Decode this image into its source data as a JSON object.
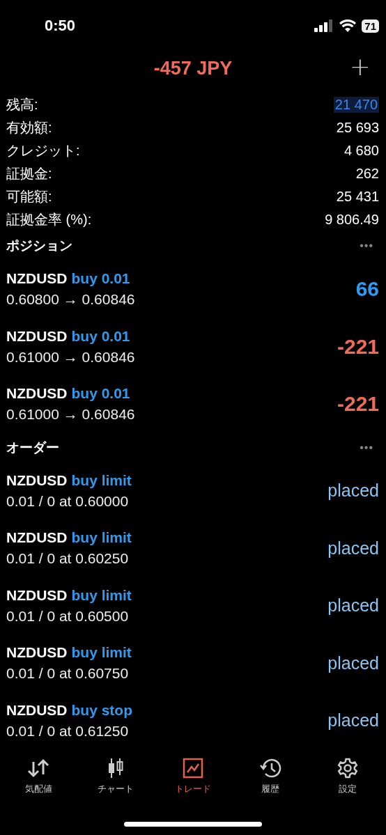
{
  "status_bar": {
    "time": "0:50",
    "battery": "71"
  },
  "header": {
    "title": "-457 JPY",
    "add": "+"
  },
  "summary": [
    {
      "label": "残高:",
      "value": "21 470",
      "highlighted": true
    },
    {
      "label": "有効額:",
      "value": "25 693",
      "highlighted": false
    },
    {
      "label": "クレジット:",
      "value": "4 680",
      "highlighted": false
    },
    {
      "label": "証拠金:",
      "value": "262",
      "highlighted": false
    },
    {
      "label": "可能額:",
      "value": "25 431",
      "highlighted": false
    },
    {
      "label": "証拠金率 (%):",
      "value": "9 806.49",
      "highlighted": false
    }
  ],
  "positions": {
    "title": "ポジション",
    "more": "•••",
    "items": [
      {
        "symbol": "NZDUSD",
        "side": "buy 0.01",
        "prices": "0.60800 → 0.60846",
        "profit": "66",
        "color": "#2f9bf0"
      },
      {
        "symbol": "NZDUSD",
        "side": "buy 0.01",
        "prices": "0.61000 → 0.60846",
        "profit": "-221",
        "color": "#ef6b5b"
      },
      {
        "symbol": "NZDUSD",
        "side": "buy 0.01",
        "prices": "0.61000 → 0.60846",
        "profit": "-221",
        "color": "#ef6b5b"
      }
    ]
  },
  "orders": {
    "title": "オーダー",
    "more": "•••",
    "items": [
      {
        "symbol": "NZDUSD",
        "side": "buy limit",
        "details": "0.01 / 0 at 0.60000",
        "state": "placed"
      },
      {
        "symbol": "NZDUSD",
        "side": "buy limit",
        "details": "0.01 / 0 at 0.60250",
        "state": "placed"
      },
      {
        "symbol": "NZDUSD",
        "side": "buy limit",
        "details": "0.01 / 0 at 0.60500",
        "state": "placed"
      },
      {
        "symbol": "NZDUSD",
        "side": "buy limit",
        "details": "0.01 / 0 at 0.60750",
        "state": "placed"
      },
      {
        "symbol": "NZDUSD",
        "side": "buy stop",
        "details": "0.01 / 0 at 0.61250",
        "state": "placed"
      }
    ]
  },
  "tabs": [
    {
      "label": "気配値",
      "kind": "quotes",
      "selected": false
    },
    {
      "label": "チャート",
      "kind": "chart",
      "selected": false
    },
    {
      "label": "トレード",
      "kind": "trade",
      "selected": true
    },
    {
      "label": "履歴",
      "kind": "history",
      "selected": false
    },
    {
      "label": "設定",
      "kind": "settings",
      "selected": false
    }
  ]
}
